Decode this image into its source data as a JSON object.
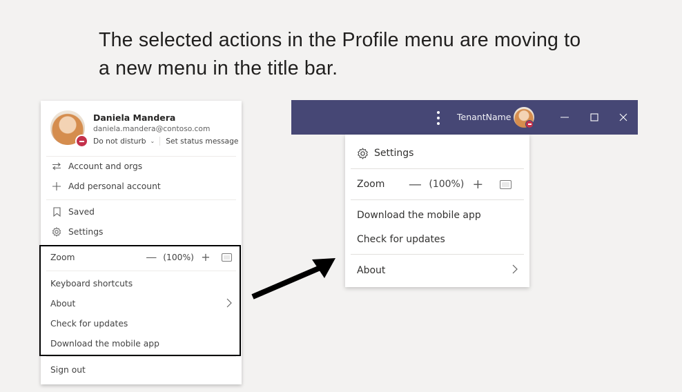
{
  "headline": {
    "line1": "The selected actions in the Profile menu are moving to",
    "line2": "a new menu in the title bar."
  },
  "profile_menu": {
    "user": {
      "name": "Daniela Mandera",
      "email": "daniela.mandera@contoso.com",
      "presence": "Do not disturb",
      "presence_color": "#c4314b",
      "set_status_label": "Set status message"
    },
    "account_items": [
      {
        "icon": "switch-arrows-icon",
        "label": "Account and orgs"
      },
      {
        "icon": "plus-icon",
        "label": "Add personal account"
      }
    ],
    "app_items": [
      {
        "icon": "bookmark-icon",
        "label": "Saved"
      },
      {
        "icon": "gear-icon",
        "label": "Settings"
      }
    ],
    "zoom": {
      "label": "Zoom",
      "value": "(100%)",
      "decrease": "—",
      "increase": "+"
    },
    "highlighted_items": [
      {
        "label": "Keyboard shortcuts"
      },
      {
        "label": "About",
        "has_submenu": true
      },
      {
        "label": "Check for updates"
      },
      {
        "label": "Download the mobile app"
      }
    ],
    "sign_out_label": "Sign out"
  },
  "titlebar": {
    "background": "#464775",
    "tenant_name": "TenantName",
    "more_icon": "more-vertical-icon",
    "window_controls": [
      "minimize",
      "maximize",
      "close"
    ]
  },
  "more_menu": {
    "settings_label": "Settings",
    "zoom": {
      "label": "Zoom",
      "value": "(100%)",
      "decrease": "—",
      "increase": "+"
    },
    "items": [
      {
        "label": "Download the mobile app"
      },
      {
        "label": "Check for updates"
      }
    ],
    "about": {
      "label": "About",
      "has_submenu": true
    }
  },
  "chevron_glyph": "›"
}
